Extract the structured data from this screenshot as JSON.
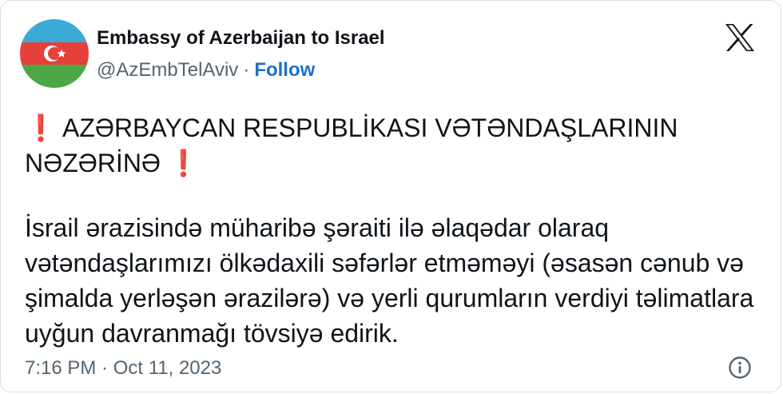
{
  "author": {
    "name": "Embassy of Azerbaijan to Israel",
    "handle": "@AzEmbTelAviv",
    "separator": "·",
    "follow_label": "Follow",
    "avatar_icon": "azerbaijan-flag-icon"
  },
  "platform_icon": "x-logo-icon",
  "tweet": {
    "exclaim_left": "❗",
    "heading": "AZƏRBAYCAN RESPUBLİKASI VƏTƏNDAŞLARININ NƏZƏRİNƏ",
    "exclaim_right": "❗",
    "body": "İsrail ərazisində müharibə şəraiti ilə əlaqədar olaraq vətəndaşlarımızı ölkədaxili səfərlər etməməyi (əsasən cənub və şimalda yerləşən ərazilərə) və yerli qurumların verdiyi təlimatlara uyğun davranmağı tövsiyə edirik."
  },
  "meta": {
    "timestamp": "7:16 PM · Oct 11, 2023",
    "info_icon": "info-icon"
  },
  "colors": {
    "flag_blue": "#3AAAD7",
    "flag_red": "#E5403B",
    "flag_green": "#4BA845",
    "follow": "#1D6FC9",
    "muted": "#536471",
    "exclaim": "#D62B2B"
  }
}
